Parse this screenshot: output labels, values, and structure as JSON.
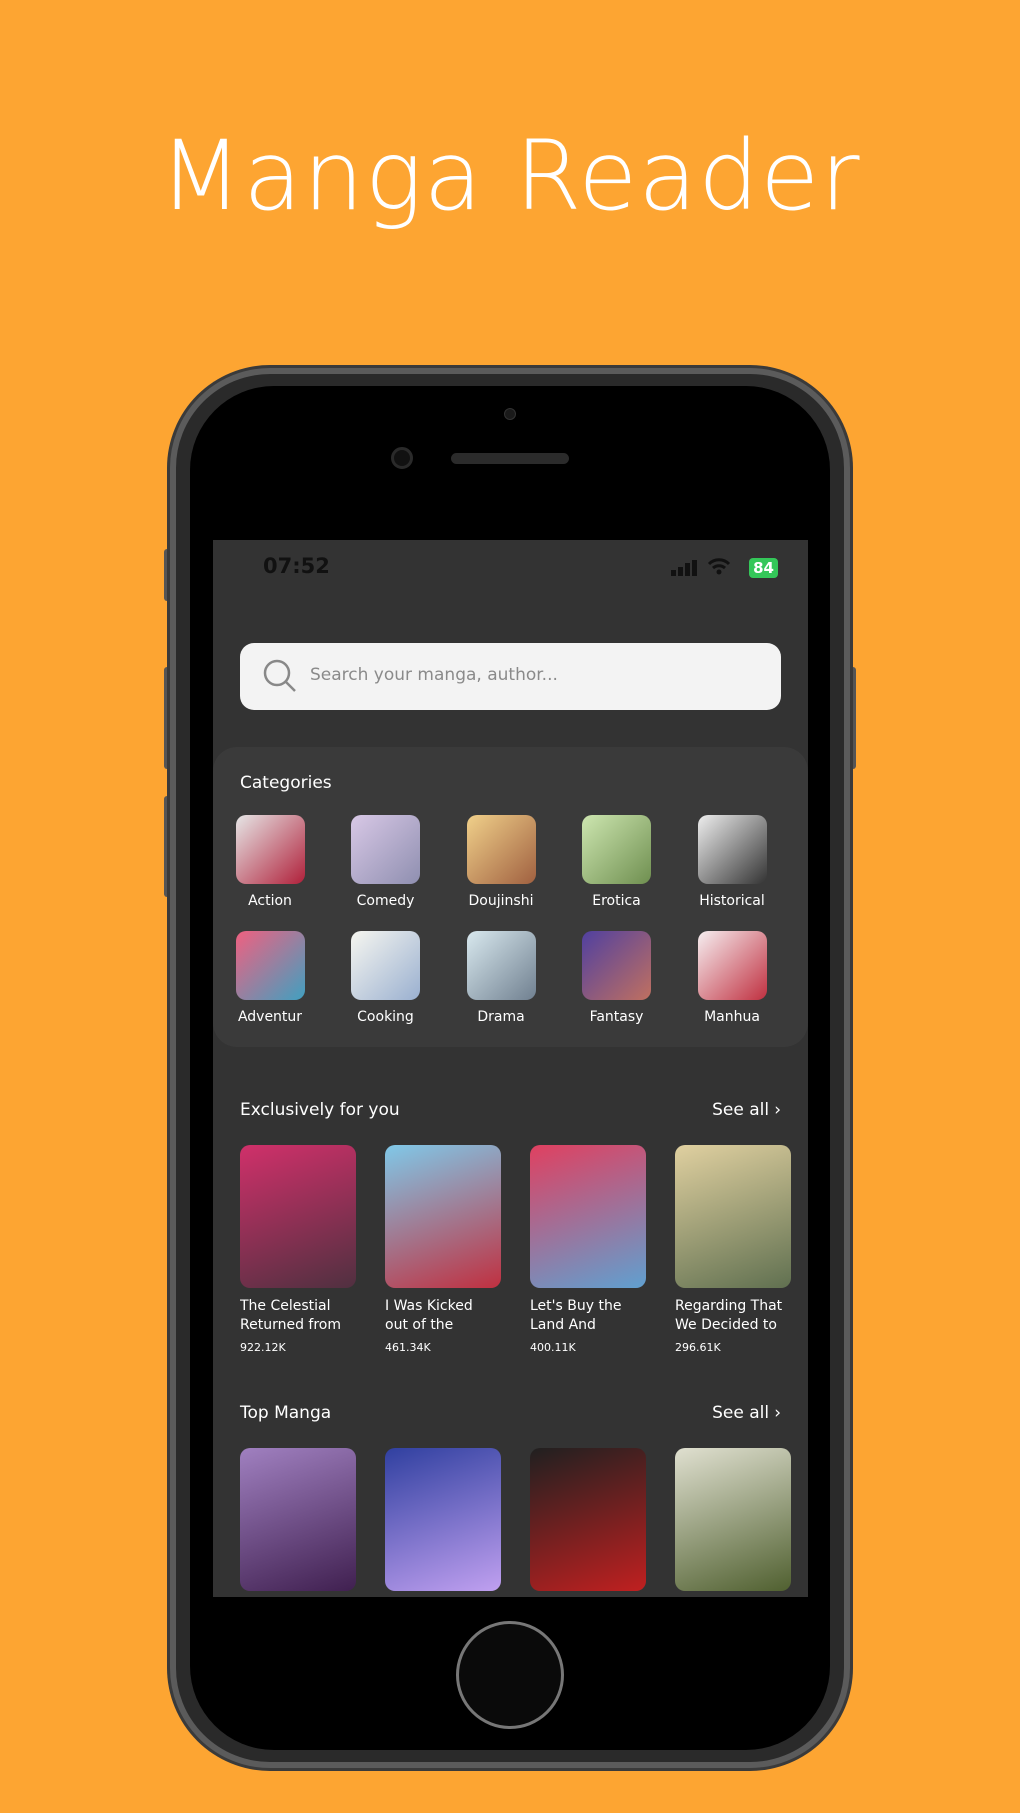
{
  "title": "Manga Reader",
  "status": {
    "time": "07:52",
    "battery": "84"
  },
  "search": {
    "placeholder": "Search your manga, author..."
  },
  "categories": {
    "heading": "Categories",
    "items": [
      {
        "label": "Action",
        "c1": "#e6e6e6",
        "c2": "#b0203a"
      },
      {
        "label": "Comedy",
        "c1": "#d8c8e6",
        "c2": "#8f8fb0"
      },
      {
        "label": "Doujinshi",
        "c1": "#f0d08a",
        "c2": "#a06040"
      },
      {
        "label": "Erotica",
        "c1": "#cde6b0",
        "c2": "#6f8f50"
      },
      {
        "label": "Historical",
        "c1": "#eeeeee",
        "c2": "#333333"
      },
      {
        "label": "Adventur",
        "c1": "#f06080",
        "c2": "#40a0c0"
      },
      {
        "label": "Cooking",
        "c1": "#f6f6f0",
        "c2": "#9ab0d0"
      },
      {
        "label": "Drama",
        "c1": "#d8e8ee",
        "c2": "#708090"
      },
      {
        "label": "Fantasy",
        "c1": "#5040a0",
        "c2": "#c07060"
      },
      {
        "label": "Manhua",
        "c1": "#f6eef0",
        "c2": "#c03040"
      }
    ]
  },
  "exclusive": {
    "heading": "Exclusively for you",
    "see_all": "See all",
    "items": [
      {
        "title1": "The Celestial",
        "title2": "Returned from",
        "count": "922.12K",
        "c1": "#d0306a",
        "c2": "#503040"
      },
      {
        "title1": "I Was Kicked",
        "title2": "out of the",
        "count": "461.34K",
        "c1": "#80c8e8",
        "c2": "#c03040"
      },
      {
        "title1": "Let's Buy the",
        "title2": "Land And",
        "count": "400.11K",
        "c1": "#e04060",
        "c2": "#60a0d0"
      },
      {
        "title1": "Regarding That",
        "title2": "We Decided to",
        "count": "296.61K",
        "c1": "#e0d0a0",
        "c2": "#607050"
      }
    ]
  },
  "top": {
    "heading": "Top Manga",
    "see_all": "See all",
    "items": [
      {
        "c1": "#a080c0",
        "c2": "#402050"
      },
      {
        "c1": "#3040a0",
        "c2": "#c0a0f0"
      },
      {
        "c1": "#202020",
        "c2": "#c02020"
      },
      {
        "c1": "#e0e0d0",
        "c2": "#506030"
      }
    ]
  }
}
